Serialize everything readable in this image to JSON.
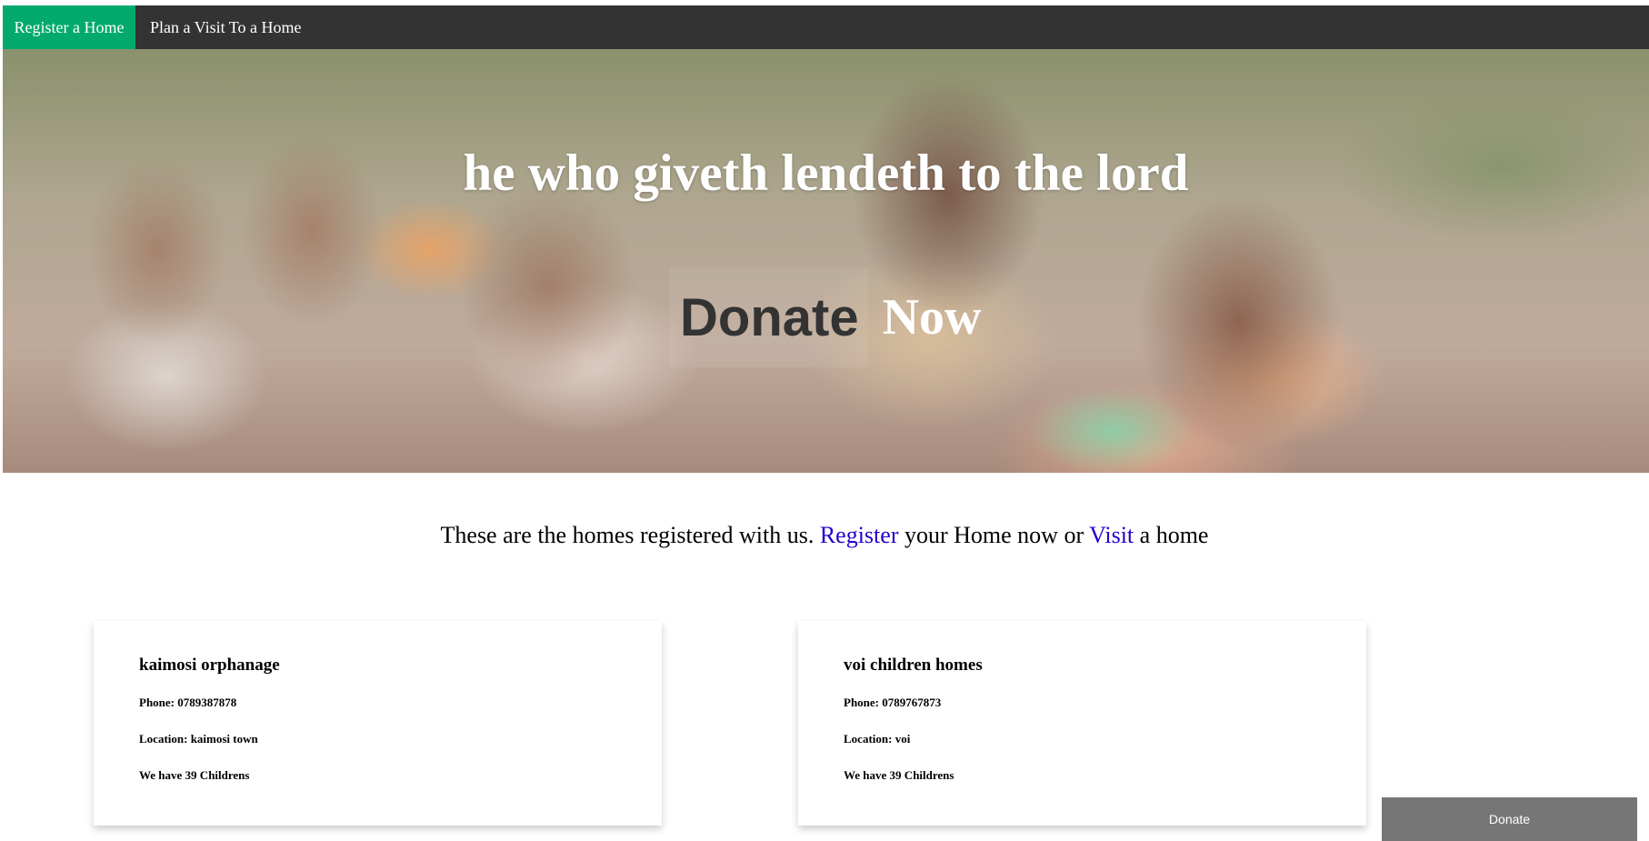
{
  "nav": {
    "items": [
      {
        "label": "Register a Home",
        "active": true
      },
      {
        "label": "Plan a Visit To a Home",
        "active": false
      }
    ],
    "active_color": "#04AA6D",
    "bar_color": "#333333"
  },
  "hero": {
    "quote": "he who giveth lendeth to the lord",
    "donate_word": "Donate",
    "now_word": "Now"
  },
  "intro": {
    "text_before": "These are the homes registered with us.",
    "register_link": "Register",
    "text_middle": "your Home now or",
    "visit_link": "Visit",
    "text_after": "a home",
    "link_color": "#2200cc"
  },
  "homes": [
    {
      "name": "kaimosi orphanage",
      "phone": "Phone: 0789387878",
      "location": "Location: kaimosi town",
      "children": "We have 39 Childrens"
    },
    {
      "name": "voi children homes",
      "phone": "Phone: 0789767873",
      "location": "Location: voi",
      "children": "We have 39 Childrens"
    }
  ],
  "donate_button": {
    "label": "Donate",
    "color": "#767676"
  }
}
